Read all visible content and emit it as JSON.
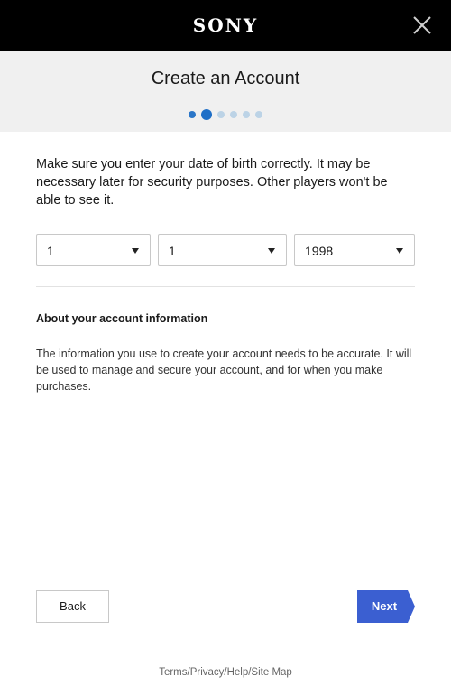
{
  "brand": {
    "logo_text": "SONY"
  },
  "header": {
    "title": "Create an Account",
    "steps": {
      "total": 6,
      "current": 2
    }
  },
  "intro_text": "Make sure you enter your date of birth correctly. It may be necessary later for security purposes. Other players won't be able to see it.",
  "dob": {
    "month": "1",
    "day": "1",
    "year": "1998"
  },
  "about": {
    "heading": "About your account information",
    "body": "The information you use to create your account needs to be accurate. It will be used to manage and secure your account, and for when you make purchases."
  },
  "buttons": {
    "back": "Back",
    "next": "Next"
  },
  "footer": {
    "links_text": "Terms/Privacy/Help/Site Map"
  },
  "colors": {
    "accent": "#3b5fd1",
    "step_active": "#1f6fc7",
    "step_inactive": "#bcd3e6",
    "topbar": "#000000",
    "header_bg": "#f0f0f0"
  }
}
